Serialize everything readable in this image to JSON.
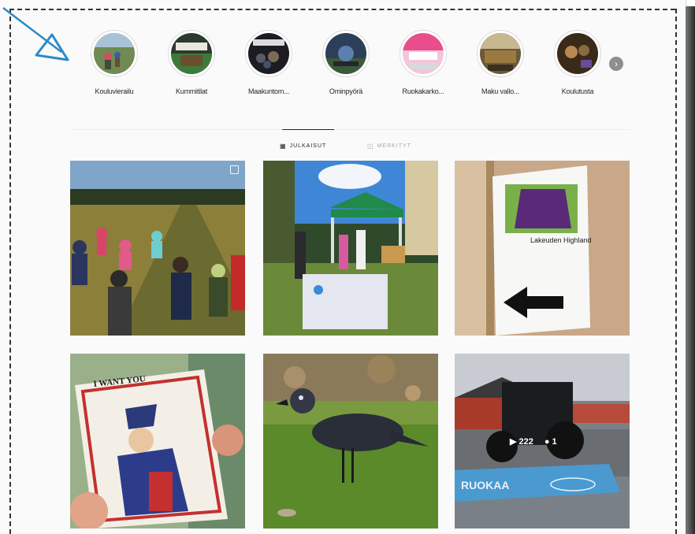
{
  "highlights": [
    {
      "label": "Kouluvierailu"
    },
    {
      "label": "Kummitilat"
    },
    {
      "label": "Maakuntom..."
    },
    {
      "label": "Ominpyörä"
    },
    {
      "label": "Ruokakarko..."
    },
    {
      "label": "Maku vallo..."
    },
    {
      "label": "Koulutusta"
    }
  ],
  "tabs": {
    "posts": "JULKAISUT",
    "tagged": "MERKITYT"
  },
  "posts": [
    {
      "id": 1,
      "type": "carousel"
    },
    {
      "id": 2,
      "type": "photo"
    },
    {
      "id": 3,
      "type": "photo",
      "sign_text": "Lakeuden Highland"
    },
    {
      "id": 4,
      "type": "photo",
      "poster_text": "I WANT YOU"
    },
    {
      "id": 5,
      "type": "photo"
    },
    {
      "id": 6,
      "type": "video",
      "views": "222",
      "comments": "1",
      "banner_text": "RUOKAA"
    }
  ],
  "colors": {
    "accent": "#2a8bc6",
    "text": "#262626",
    "muted": "#a8a8a8"
  }
}
